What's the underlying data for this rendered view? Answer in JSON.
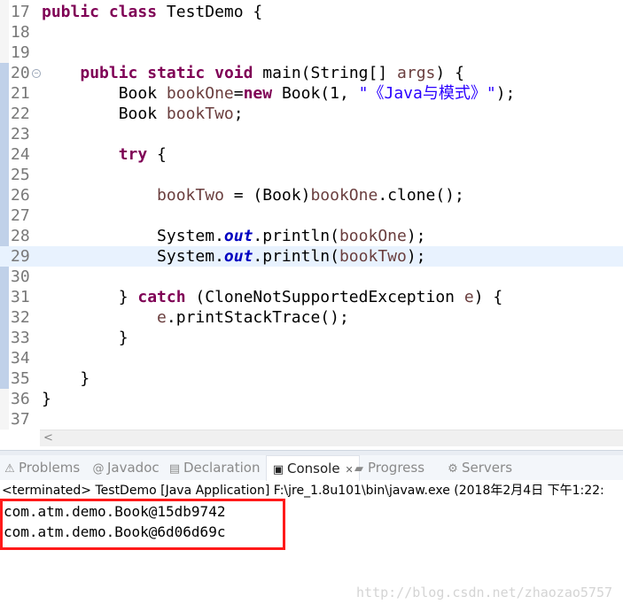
{
  "editor": {
    "current_line": 29,
    "fold_marker_line": 20,
    "lines": [
      {
        "n": "17",
        "tokens": [
          [
            "public",
            "kw"
          ],
          [
            " ",
            ""
          ],
          [
            "class",
            "kw"
          ],
          [
            " TestDemo {",
            ""
          ]
        ]
      },
      {
        "n": "18",
        "tokens": []
      },
      {
        "n": "19",
        "tokens": []
      },
      {
        "n": "20",
        "tokens": [
          [
            "    ",
            ""
          ],
          [
            "public",
            "kw"
          ],
          [
            " ",
            ""
          ],
          [
            "static",
            "kw"
          ],
          [
            " ",
            ""
          ],
          [
            "void",
            "kw"
          ],
          [
            " main(String[] ",
            ""
          ],
          [
            "args",
            "var"
          ],
          [
            ") {",
            ""
          ]
        ]
      },
      {
        "n": "21",
        "tokens": [
          [
            "        Book ",
            ""
          ],
          [
            "bookOne",
            "var"
          ],
          [
            "=",
            ""
          ],
          [
            "new",
            "kw"
          ],
          [
            " Book(1, ",
            ""
          ],
          [
            "\"《Java与模式》\"",
            "str"
          ],
          [
            ");",
            ""
          ]
        ]
      },
      {
        "n": "22",
        "tokens": [
          [
            "        Book ",
            ""
          ],
          [
            "bookTwo",
            "var"
          ],
          [
            ";",
            ""
          ]
        ]
      },
      {
        "n": "23",
        "tokens": []
      },
      {
        "n": "24",
        "tokens": [
          [
            "        ",
            ""
          ],
          [
            "try",
            "kw"
          ],
          [
            " {",
            ""
          ]
        ]
      },
      {
        "n": "25",
        "tokens": []
      },
      {
        "n": "26",
        "tokens": [
          [
            "            ",
            ""
          ],
          [
            "bookTwo",
            "var"
          ],
          [
            " = (Book)",
            ""
          ],
          [
            "bookOne",
            "var"
          ],
          [
            ".clone();",
            ""
          ]
        ]
      },
      {
        "n": "27",
        "tokens": []
      },
      {
        "n": "28",
        "tokens": [
          [
            "            System.",
            ""
          ],
          [
            "out",
            "field"
          ],
          [
            ".println(",
            ""
          ],
          [
            "bookOne",
            "var"
          ],
          [
            ");",
            ""
          ]
        ]
      },
      {
        "n": "29",
        "tokens": [
          [
            "            System.",
            ""
          ],
          [
            "out",
            "field"
          ],
          [
            ".println(",
            ""
          ],
          [
            "bookTwo",
            "var"
          ],
          [
            ");",
            ""
          ]
        ]
      },
      {
        "n": "30",
        "tokens": []
      },
      {
        "n": "31",
        "tokens": [
          [
            "        } ",
            ""
          ],
          [
            "catch",
            "kw"
          ],
          [
            " (CloneNotSupportedException ",
            ""
          ],
          [
            "e",
            "var"
          ],
          [
            ") {",
            ""
          ]
        ]
      },
      {
        "n": "32",
        "tokens": [
          [
            "            ",
            ""
          ],
          [
            "e",
            "var"
          ],
          [
            ".printStackTrace();",
            ""
          ]
        ]
      },
      {
        "n": "33",
        "tokens": [
          [
            "        }",
            ""
          ]
        ]
      },
      {
        "n": "34",
        "tokens": []
      },
      {
        "n": "35",
        "tokens": [
          [
            "    }",
            ""
          ]
        ]
      },
      {
        "n": "36",
        "tokens": [
          [
            "}",
            ""
          ]
        ]
      },
      {
        "n": "37",
        "tokens": []
      }
    ]
  },
  "tabs": [
    {
      "label": "Problems",
      "icon": "problems-icon",
      "glyph": "⚠",
      "active": false
    },
    {
      "label": "Javadoc",
      "icon": "at-icon",
      "glyph": "@",
      "active": false
    },
    {
      "label": "Declaration",
      "icon": "declaration-icon",
      "glyph": "▤",
      "active": false
    },
    {
      "label": "Console",
      "icon": "console-icon",
      "glyph": "▣",
      "active": true,
      "close": "✕"
    },
    {
      "label": "Progress",
      "icon": "progress-icon",
      "glyph": "▰",
      "active": false
    },
    {
      "label": "Servers",
      "icon": "servers-icon",
      "glyph": "⚙",
      "active": false
    }
  ],
  "console": {
    "header": "<terminated> TestDemo [Java Application] F:\\jre_1.8u101\\bin\\javaw.exe (2018年2月4日 下午1:22:",
    "output": [
      "com.atm.demo.Book@15db9742",
      "com.atm.demo.Book@6d06d69c"
    ],
    "highlight_color": "#ff1a1a"
  },
  "watermark": "http://blog.csdn.net/zhaozao5757"
}
